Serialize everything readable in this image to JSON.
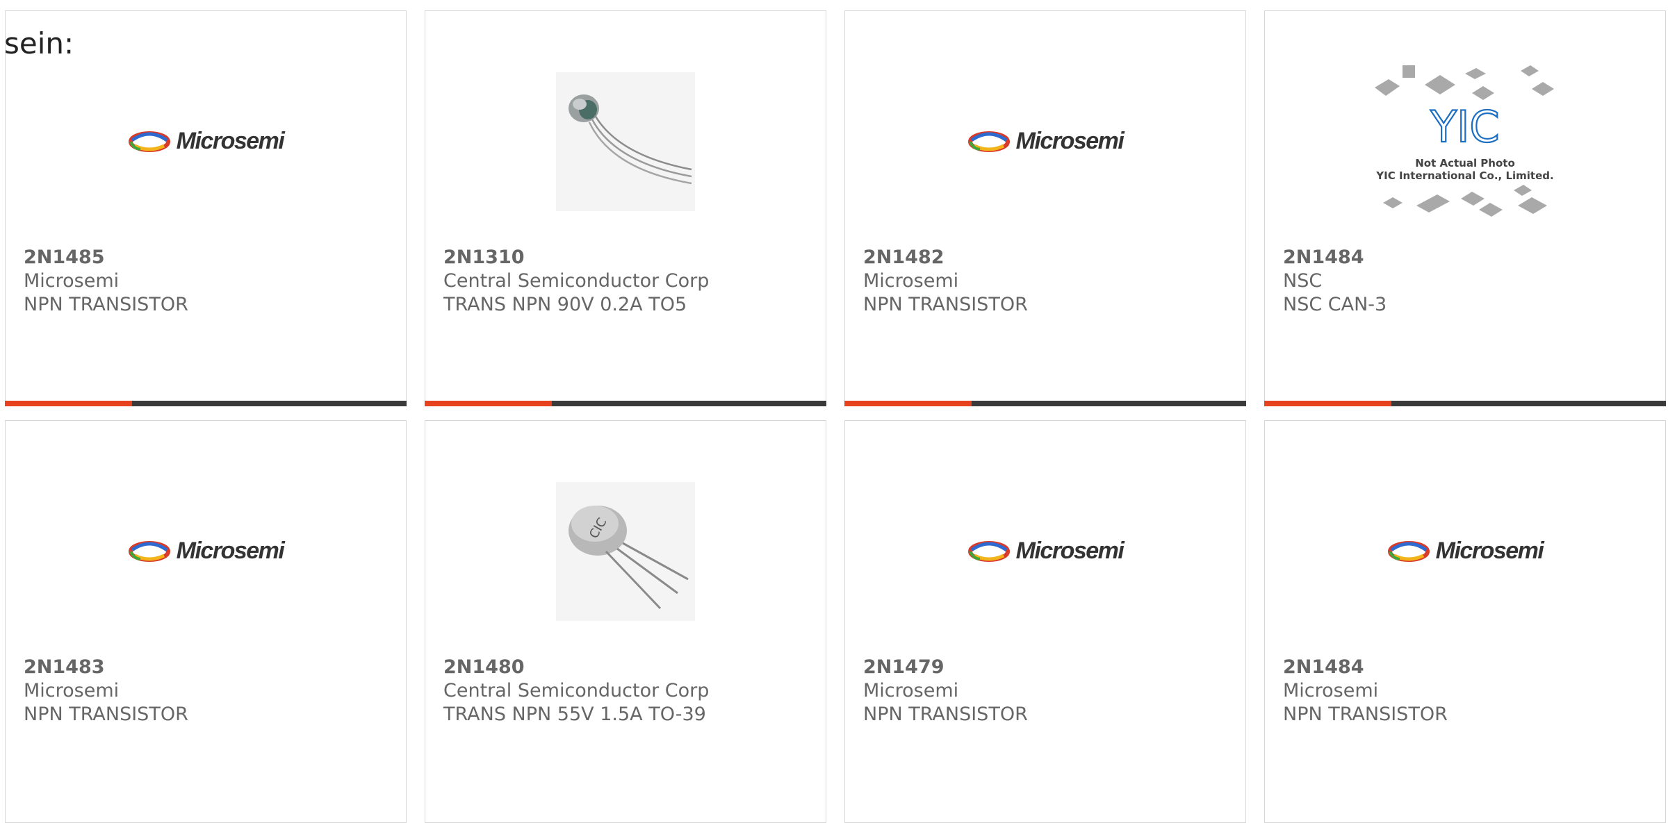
{
  "lead_text": "sein:",
  "products": [
    {
      "part": "2N1485",
      "maker": "Microsemi",
      "desc": "NPN TRANSISTOR",
      "image": "microsemi-logo"
    },
    {
      "part": "2N1310",
      "maker": "Central Semiconductor Corp",
      "desc": "TRANS NPN 90V 0.2A TO5",
      "image": "to5-transistor-photo"
    },
    {
      "part": "2N1482",
      "maker": "Microsemi",
      "desc": "NPN TRANSISTOR",
      "image": "microsemi-logo"
    },
    {
      "part": "2N1484",
      "maker": "NSC",
      "desc": "NSC CAN-3",
      "image": "yic-placeholder",
      "placeholder_text": [
        "Not Actual Photo",
        "YIC International Co., Limited."
      ],
      "placeholder_logo": "YIC"
    },
    {
      "part": "2N1483",
      "maker": "Microsemi",
      "desc": "NPN TRANSISTOR",
      "image": "microsemi-logo"
    },
    {
      "part": "2N1480",
      "maker": "Central Semiconductor Corp",
      "desc": "TRANS NPN 55V 1.5A TO-39",
      "image": "to39-transistor-photo"
    },
    {
      "part": "2N1479",
      "maker": "Microsemi",
      "desc": "NPN TRANSISTOR",
      "image": "microsemi-logo"
    },
    {
      "part": "2N1484",
      "maker": "Microsemi",
      "desc": "NPN TRANSISTOR",
      "image": "microsemi-logo"
    }
  ],
  "logo_text": "Microsemi",
  "colors": {
    "accent": "#e8411d",
    "bar": "#3a3a3a",
    "border": "#d6d6d6",
    "text": "#666666"
  }
}
